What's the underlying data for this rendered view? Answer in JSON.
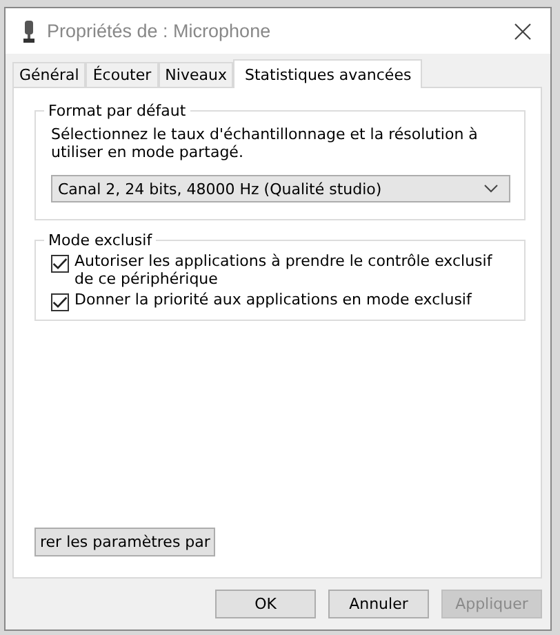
{
  "window": {
    "title": "Propriétés de : Microphone"
  },
  "tabs": [
    {
      "label": "Général",
      "selected": false
    },
    {
      "label": "Écouter",
      "selected": false
    },
    {
      "label": "Niveaux",
      "selected": false
    },
    {
      "label": "Statistiques avancées",
      "selected": true
    }
  ],
  "default_format": {
    "title": "Format par défaut",
    "description": "Sélectionnez le taux d'échantillonnage et la résolution à utiliser en mode partagé.",
    "dropdown": {
      "value": "Canal 2, 24 bits, 48000 Hz (Qualité studio)"
    }
  },
  "exclusive_mode": {
    "title": "Mode exclusif",
    "options": [
      {
        "label": "Autoriser les applications à prendre le contrôle exclusif de ce périphérique",
        "checked": true
      },
      {
        "label": "Donner la priorité aux applications en mode exclusif",
        "checked": true
      }
    ]
  },
  "restore_button": {
    "label": "rer les paramètres par"
  },
  "buttons": [
    {
      "label": "OK",
      "disabled": false
    },
    {
      "label": "Annuler",
      "disabled": false
    },
    {
      "label": "Appliquer",
      "disabled": true
    }
  ]
}
